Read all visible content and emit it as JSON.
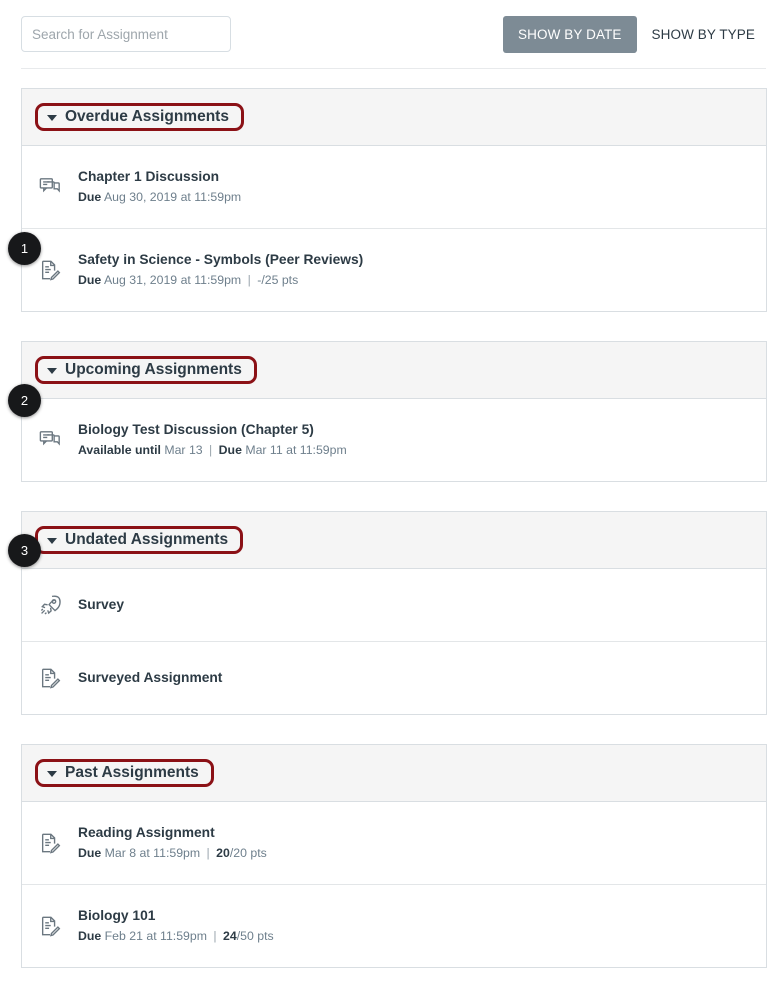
{
  "toolbar": {
    "search": {
      "placeholder": "Search for Assignment",
      "value": ""
    },
    "show_by_date_label": "SHOW BY DATE",
    "show_by_type_label": "SHOW BY TYPE",
    "active_toggle": "SHOW BY DATE"
  },
  "callouts": [
    {
      "number": "1"
    },
    {
      "number": "2"
    },
    {
      "number": "3"
    }
  ],
  "groups": [
    {
      "title": "Overdue Assignments",
      "expanded": true,
      "items": [
        {
          "title": "Chapter 1 Discussion",
          "icon": "discussion-icon",
          "due_label": "Due",
          "due_value": "Aug 30, 2019 at 11:59pm",
          "points": ""
        },
        {
          "title": "Safety in Science - Symbols (Peer Reviews)",
          "icon": "assignment-icon",
          "due_label": "Due",
          "due_value": "Aug 31, 2019 at 11:59pm",
          "points": "-/25 pts",
          "points_score": "",
          "points_rest": "-/25 pts"
        }
      ]
    },
    {
      "title": "Upcoming Assignments",
      "expanded": true,
      "items": [
        {
          "title": "Biology Test Discussion (Chapter 5)",
          "icon": "discussion-icon",
          "available_label": "Available until",
          "available_value": "Mar 13",
          "due_label": "Due",
          "due_value": "Mar 11 at 11:59pm"
        }
      ]
    },
    {
      "title": "Undated Assignments",
      "expanded": true,
      "items": [
        {
          "title": "Survey",
          "icon": "quiz-rocket-icon"
        },
        {
          "title": "Surveyed Assignment",
          "icon": "assignment-icon"
        }
      ]
    },
    {
      "title": "Past Assignments",
      "expanded": true,
      "items": [
        {
          "title": "Reading Assignment",
          "icon": "assignment-icon",
          "due_label": "Due",
          "due_value": "Mar 8 at 11:59pm",
          "points_score": "20",
          "points_rest": "/20 pts"
        },
        {
          "title": "Biology 101",
          "icon": "assignment-icon",
          "due_label": "Due",
          "due_value": "Feb 21 at 11:59pm",
          "points_score": "24",
          "points_rest": "/50 pts"
        }
      ]
    }
  ],
  "colors": {
    "highlight_outline": "#8B1116",
    "active_toggle_bg": "#7d8b95",
    "title_text": "#2D3B45",
    "meta_text": "#6E7F8C",
    "group_header_bg": "#F5F5F5",
    "border": "#D9DEE2",
    "badge_bg": "#17181A"
  }
}
